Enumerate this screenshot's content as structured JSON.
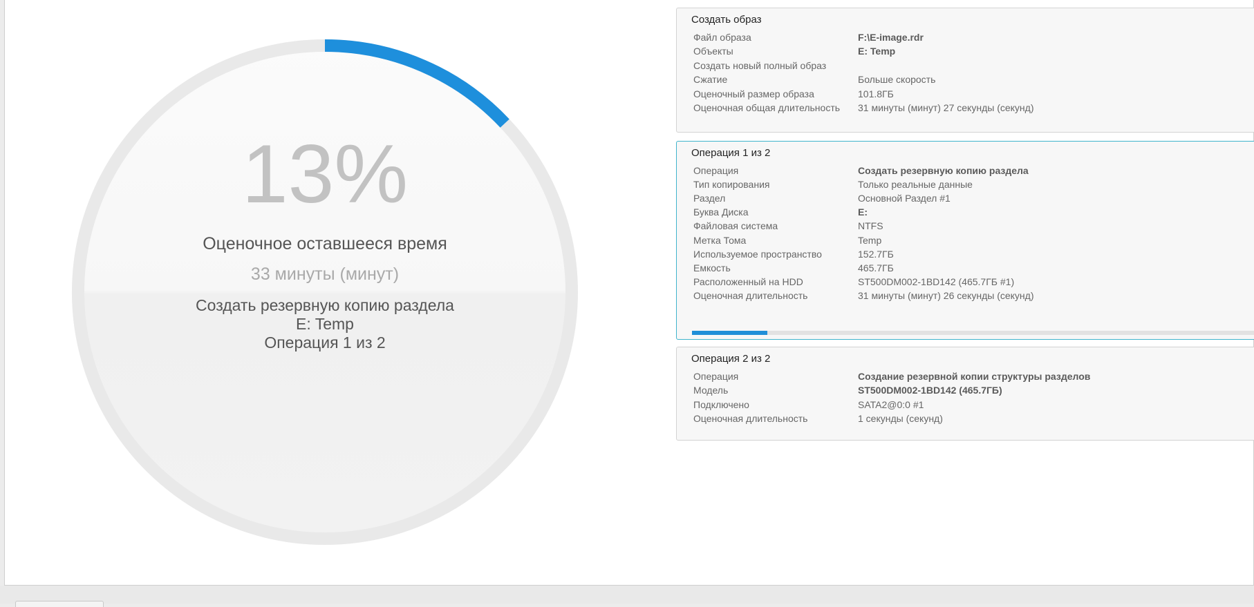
{
  "progress": {
    "percent_text": "13%",
    "fraction": 0.13,
    "remaining_label": "Оценочное оставшееся время",
    "remaining_value": "33 минуты (минут)",
    "operation_name": "Создать резервную копию раздела",
    "target": "E: Temp",
    "operation_counter": "Операция 1 из 2",
    "accent_color": "#1e8fdc",
    "track_color": "#e9e9e9"
  },
  "image_panel": {
    "title": "Создать образ",
    "rows": [
      {
        "key": "Файл образа",
        "value": "F:\\E-image.rdr",
        "bold": true
      },
      {
        "key": "Объекты",
        "value": "E: Temp",
        "bold": true
      },
      {
        "key": "Создать новый полный образ",
        "value": "",
        "bold": false
      },
      {
        "key": "Сжатие",
        "value": "Больше скорость",
        "bold": false
      },
      {
        "key": "Оценочный размер образа",
        "value": "101.8ГБ",
        "bold": false
      },
      {
        "key": "Оценочная общая длительность",
        "value": "31 минуты (минут) 27 секунды (секунд)",
        "bold": false
      }
    ]
  },
  "op1_panel": {
    "title": "Операция 1 из 2",
    "progress_fraction": 0.13,
    "rows": [
      {
        "key": "Операция",
        "value": "Создать резервную копию раздела",
        "bold": true
      },
      {
        "key": "Тип копирования",
        "value": "Только реальные данные",
        "bold": false
      },
      {
        "key": "Раздел",
        "value": "Основной Раздел #1",
        "bold": false
      },
      {
        "key": "Буква Диска",
        "value": "E:",
        "bold": true
      },
      {
        "key": "Файловая система",
        "value": "NTFS",
        "bold": false
      },
      {
        "key": "Метка Тома",
        "value": "Temp",
        "bold": false
      },
      {
        "key": "Используемое пространство",
        "value": "152.7ГБ",
        "bold": false
      },
      {
        "key": "Емкость",
        "value": "465.7ГБ",
        "bold": false
      },
      {
        "key": "Расположенный на HDD",
        "value": "ST500DM002-1BD142 (465.7ГБ #1)",
        "bold": false
      },
      {
        "key": "Оценочная длительность",
        "value": "31 минуты (минут) 26 секунды (секунд)",
        "bold": false
      }
    ]
  },
  "op2_panel": {
    "title": "Операция 2 из 2",
    "rows": [
      {
        "key": "Операция",
        "value": "Создание резервной копии структуры разделов",
        "bold": true
      },
      {
        "key": "Модель",
        "value": "ST500DM002-1BD142 (465.7ГБ)",
        "bold": true
      },
      {
        "key": "Подключено",
        "value": "SATA2@0:0 #1",
        "bold": false
      },
      {
        "key": "Оценочная длительность",
        "value": "1 секунды (секунд)",
        "bold": false
      }
    ]
  }
}
